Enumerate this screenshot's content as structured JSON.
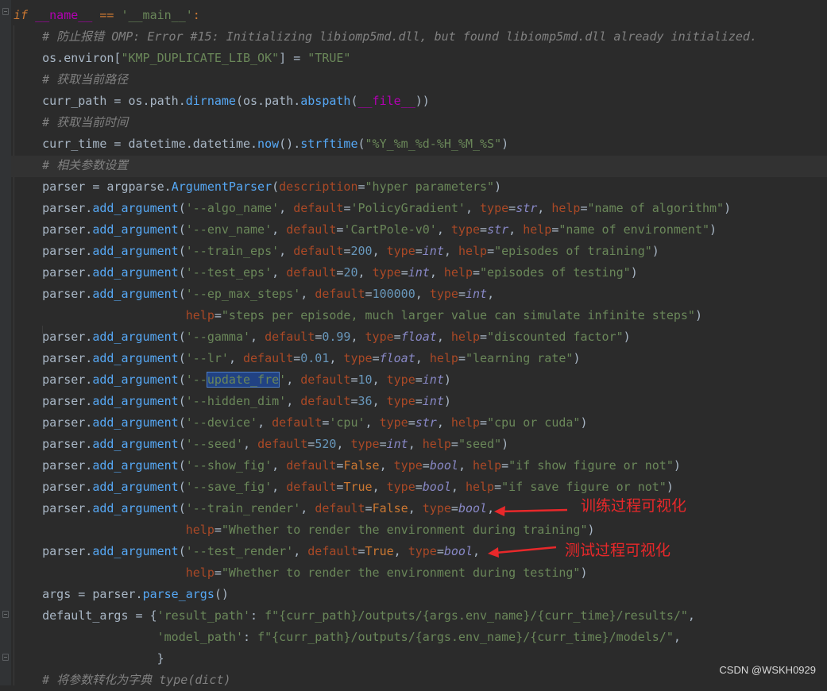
{
  "lines": [
    "if __name__ == '__main__':",
    "    # 防止报错 OMP: Error #15: Initializing libiomp5md.dll, but found libiomp5md.dll already initialized.",
    "    os.environ[\"KMP_DUPLICATE_LIB_OK\"] = \"TRUE\"",
    "    # 获取当前路径",
    "    curr_path = os.path.dirname(os.path.abspath(__file__))",
    "    # 获取当前时间",
    "    curr_time = datetime.datetime.now().strftime(\"%Y_%m_%d-%H_%M_%S\")",
    "    # 相关参数设置",
    "    parser = argparse.ArgumentParser(description=\"hyper parameters\")",
    "    parser.add_argument('--algo_name', default='PolicyGradient', type=str, help=\"name of algorithm\")",
    "    parser.add_argument('--env_name', default='CartPole-v0', type=str, help=\"name of environment\")",
    "    parser.add_argument('--train_eps', default=200, type=int, help=\"episodes of training\")",
    "    parser.add_argument('--test_eps', default=20, type=int, help=\"episodes of testing\")",
    "    parser.add_argument('--ep_max_steps', default=100000, type=int,",
    "                        help=\"steps per episode, much larger value can simulate infinite steps\")",
    "    parser.add_argument('--gamma', default=0.99, type=float, help=\"discounted factor\")",
    "    parser.add_argument('--lr', default=0.01, type=float, help=\"learning rate\")",
    "    parser.add_argument('--update_fre', default=10, type=int)",
    "    parser.add_argument('--hidden_dim', default=36, type=int)",
    "    parser.add_argument('--device', default='cpu', type=str, help=\"cpu or cuda\")",
    "    parser.add_argument('--seed', default=520, type=int, help=\"seed\")",
    "    parser.add_argument('--show_fig', default=False, type=bool, help=\"if show figure or not\")",
    "    parser.add_argument('--save_fig', default=True, type=bool, help=\"if save figure or not\")",
    "    parser.add_argument('--train_render', default=False, type=bool,",
    "                        help=\"Whether to render the environment during training\")",
    "    parser.add_argument('--test_render', default=True, type=bool,",
    "                        help=\"Whether to render the environment during testing\")",
    "    args = parser.parse_args()",
    "    default_args = {'result_path': f\"{curr_path}/outputs/{args.env_name}/{curr_time}/results/\",",
    "                    'model_path': f\"{curr_path}/outputs/{args.env_name}/{curr_time}/models/\",",
    "                    }",
    "    # 将参数转化为字典 type(dict)"
  ],
  "annotations": {
    "train_render": "训练过程可视化",
    "test_render": "测试过程可视化"
  },
  "watermark": "CSDN @WSKH0929",
  "theme": {
    "background": "#2b2b2b",
    "keyword": "#cc7832",
    "string": "#6a8759",
    "number": "#6897bb",
    "comment": "#808080",
    "function": "#56a8f5",
    "builtin": "#8888c6",
    "parameter": "#aa4926",
    "annotation": "#e8282a"
  }
}
